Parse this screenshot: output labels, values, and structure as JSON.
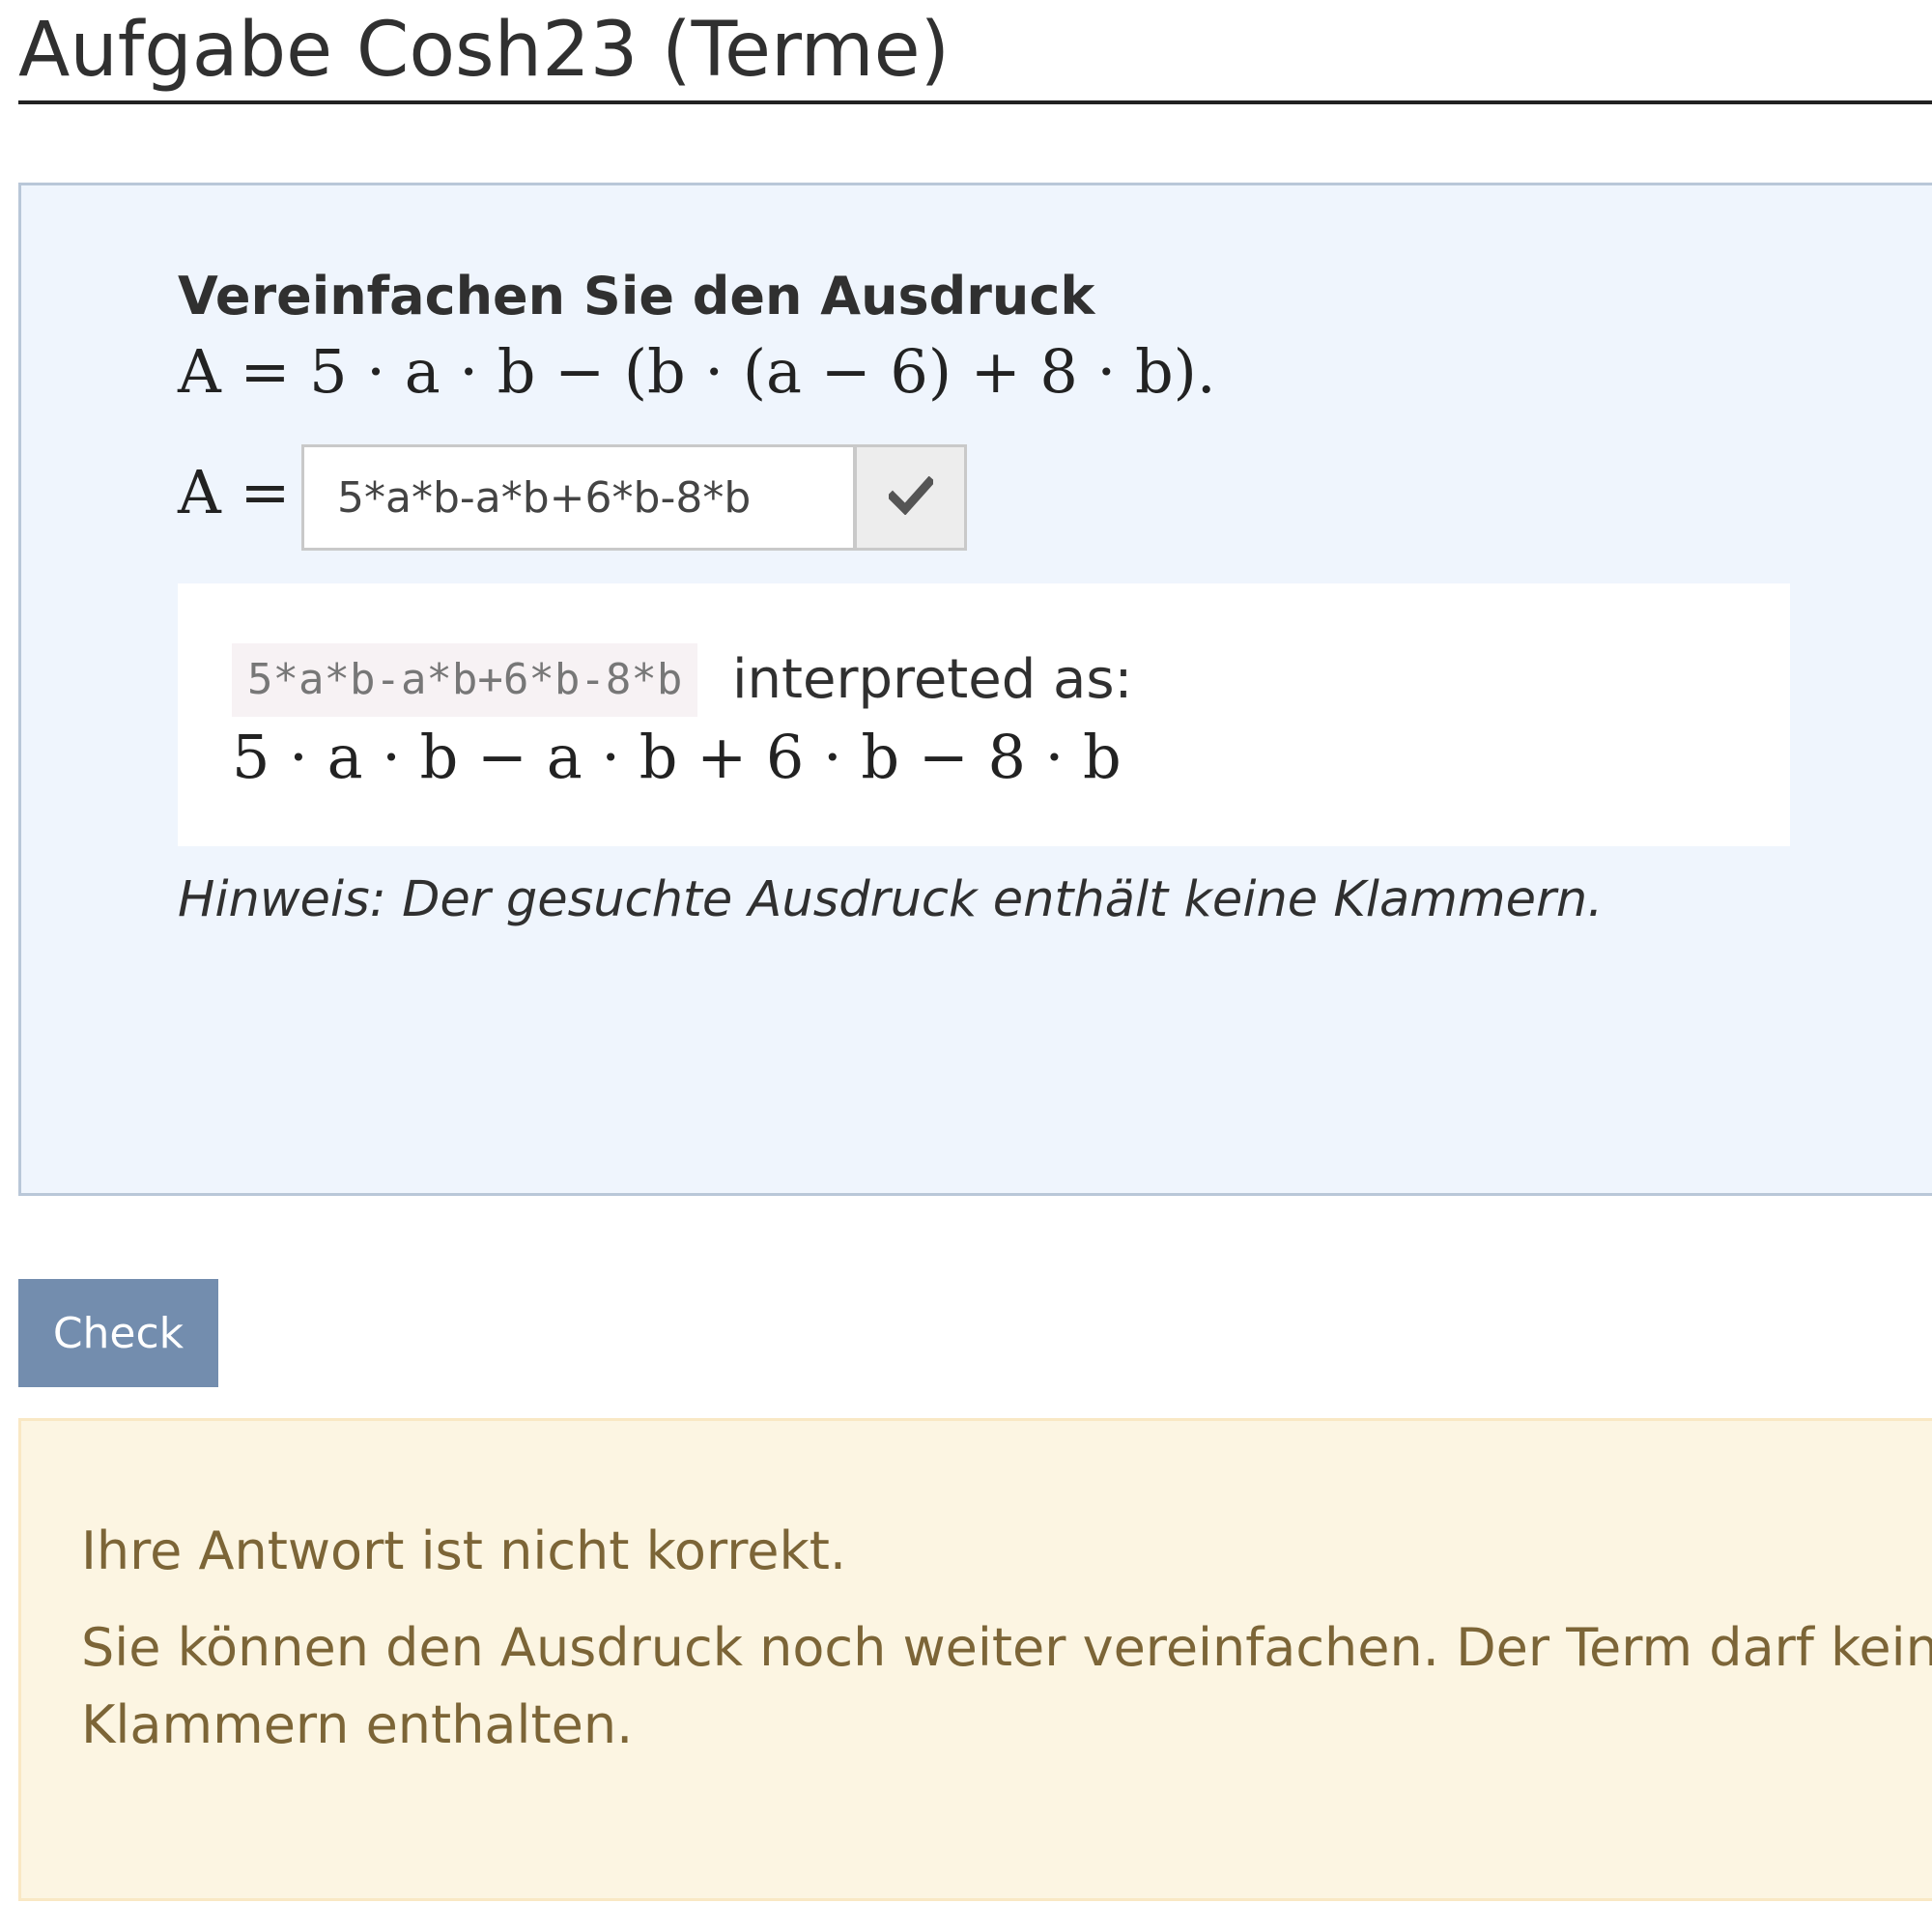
{
  "header": {
    "title": "Aufgabe Cosh23 (Terme)"
  },
  "question": {
    "prompt": "Vereinfachen Sie den Ausdruck",
    "expression": "A = 5 · a · b − (b · (a − 6) + 8 · b).",
    "answer_label": "A =",
    "answer_value": "5*a*b-a*b+6*b-8*b",
    "submit_icon": "checkmark-icon"
  },
  "preview": {
    "raw": "5*a*b-a*b+6*b-8*b",
    "label": "interpreted as:",
    "interpreted": "5 · a · b − a · b + 6 · b − 8 · b"
  },
  "hint": "Hinweis: Der gesuchte Ausdruck enthält keine Klammern.",
  "actions": {
    "check_label": "Check"
  },
  "feedback": {
    "line1": "Ihre Antwort ist nicht korrekt.",
    "line2": "Sie können den Ausdruck noch weiter vereinfachen. Der Term darf keine",
    "line3": "Klammern enthalten."
  },
  "colors": {
    "question_bg": "#eff5fd",
    "button_bg": "#738dae",
    "feedback_bg": "#fcf5e2",
    "feedback_text": "#7c6537"
  }
}
